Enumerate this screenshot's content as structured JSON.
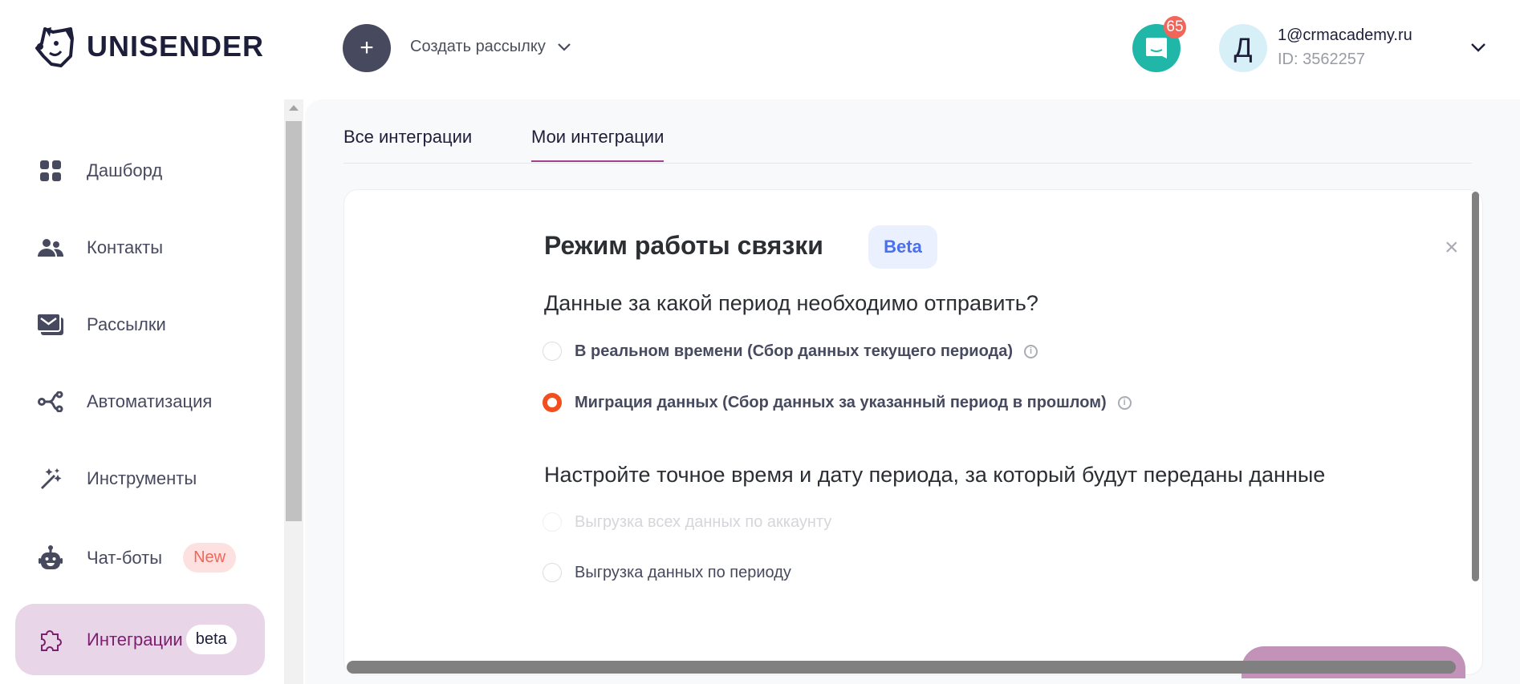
{
  "header": {
    "logo_text": "UNISENDER",
    "create_label": "Создать рассылку",
    "notifications_count": "65",
    "avatar_letter": "Д",
    "email": "1@crmacademy.ru",
    "account_id": "ID: 3562257"
  },
  "sidebar": {
    "items": [
      {
        "label": "Дашборд"
      },
      {
        "label": "Контакты"
      },
      {
        "label": "Рассылки"
      },
      {
        "label": "Автоматизация"
      },
      {
        "label": "Инструменты"
      },
      {
        "label": "Чат-боты",
        "badge": "New"
      },
      {
        "label": "Интеграции",
        "badge": "beta"
      }
    ]
  },
  "tabs": [
    {
      "label": "Все интеграции"
    },
    {
      "label": "Мои интеграции"
    }
  ],
  "modal": {
    "title": "Режим работы связки",
    "title_badge": "Beta",
    "close_icon": "×",
    "question": "Данные за какой период необходимо отправить?",
    "period_options": [
      {
        "label": "В реальном времени (Сбор данных текущего периода)",
        "selected": false
      },
      {
        "label": "Миграция данных (Сбор данных за указанный период в прошлом)",
        "selected": true
      }
    ],
    "range_heading": "Настройте точное время и дату периода, за который будут переданы данные",
    "range_options": [
      {
        "label": "Выгрузка всех данных по аккаунту",
        "disabled": true
      },
      {
        "label": "Выгрузка данных по периоду",
        "disabled": false
      }
    ]
  },
  "colors": {
    "accent": "#a0418c",
    "radio_selected": "#f24e1e",
    "chat": "#20b6a8"
  }
}
